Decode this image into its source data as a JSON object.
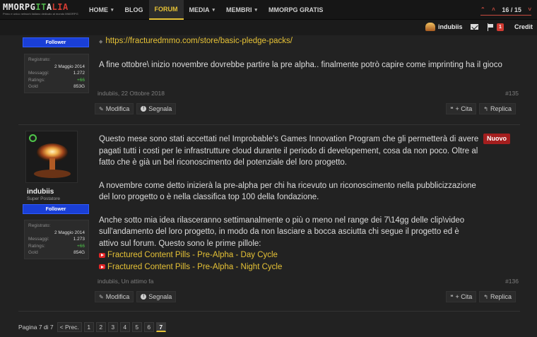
{
  "brand": {
    "logo_text_white1": "MMORPG",
    "logo_text_green": "IT",
    "logo_text_white2": "A",
    "logo_text_red": "LIA",
    "tagline": "Primo e unico network italiano dedicato al mondo MMORPG"
  },
  "nav": {
    "items": [
      {
        "label": "HOME",
        "has_caret": true
      },
      {
        "label": "BLOG",
        "has_caret": false
      },
      {
        "label": "FORUM",
        "has_caret": false,
        "active": true
      },
      {
        "label": "MEDIA",
        "has_caret": true
      },
      {
        "label": "MEMBRI",
        "has_caret": true
      },
      {
        "label": "MMORPG GRATIS",
        "has_caret": false
      }
    ],
    "page_counter": "16 / 15"
  },
  "userbar": {
    "username": "indubiis",
    "alerts_count": "1",
    "credit_label": "Credit"
  },
  "posts": [
    {
      "follow_label": "Follower",
      "stats": {
        "registered_label": "Registrato:",
        "registered_date": "2 Maggio 2014",
        "messages_label": "Messaggi:",
        "messages": "1.272",
        "ratings_label": "Ratings:",
        "ratings": "+66",
        "gold_label": "Gold",
        "gold": "853G"
      },
      "link_text": "https://fracturedmmo.com/store/basic-pledge-packs/",
      "body": "A fine ottobre\\ inizio novembre dovrebbe partire la pre alpha.. finalmente potrò capire come imprinting ha il gioco",
      "author": "indubiis",
      "date": "22 Ottobre 2018",
      "number": "#135",
      "edit_label": "Modifica",
      "report_label": "Segnala",
      "quote_label": "+ Cita",
      "reply_label": "Replica"
    },
    {
      "username": "indubiis",
      "user_title": "Super Postatore",
      "follow_label": "Follower",
      "new_badge": "Nuovo",
      "stats": {
        "registered_label": "Registrato:",
        "registered_date": "2 Maggio 2014",
        "messages_label": "Messaggi:",
        "messages": "1.273",
        "ratings_label": "Ratings:",
        "ratings": "+66",
        "gold_label": "Gold",
        "gold": "854G"
      },
      "para1": "Questo mese sono stati accettati nel Improbable's Games Innovation Program che gli permetterà di avere pagati tutti i costi per le infrastrutture cloud durante il periodo di developement, cosa da non poco. Oltre al fatto che è già un bel riconoscimento del potenziale del loro progetto.",
      "para2": "A novembre come detto inizierà la pre-alpha per chi ha ricevuto un riconoscimento nella pubblicizzazione del loro progetto o è nella classifica top 100 della fondazione.",
      "para3": "Anche sotto mia idea rilasceranno settimanalmente o più o meno nel range dei 7\\14gg delle clip\\video sull'andamento del loro progetto, in modo da non lasciare a bocca asciutta chi segue il progetto ed è attivo sul forum. Questo sono le prime pillole:",
      "video1": "Fractured Content Pills - Pre-Alpha - Day Cycle",
      "video2": "Fractured Content Pills - Pre-Alpha - Night Cycle",
      "author": "indubiis",
      "date": "Un attimo fa",
      "number": "#136",
      "edit_label": "Modifica",
      "report_label": "Segnala",
      "quote_label": "+ Cita",
      "reply_label": "Replica"
    }
  ],
  "pagination": {
    "label": "Pagina 7 di 7",
    "prev_label": "< Prec.",
    "pages": [
      "1",
      "2",
      "3",
      "4",
      "5",
      "6",
      "7"
    ],
    "current": "7"
  },
  "colors": {
    "accent_yellow": "#e6c236",
    "follow_blue": "#1a3fd6",
    "new_red": "#a41e1e",
    "rating_green": "#4fc74a"
  }
}
